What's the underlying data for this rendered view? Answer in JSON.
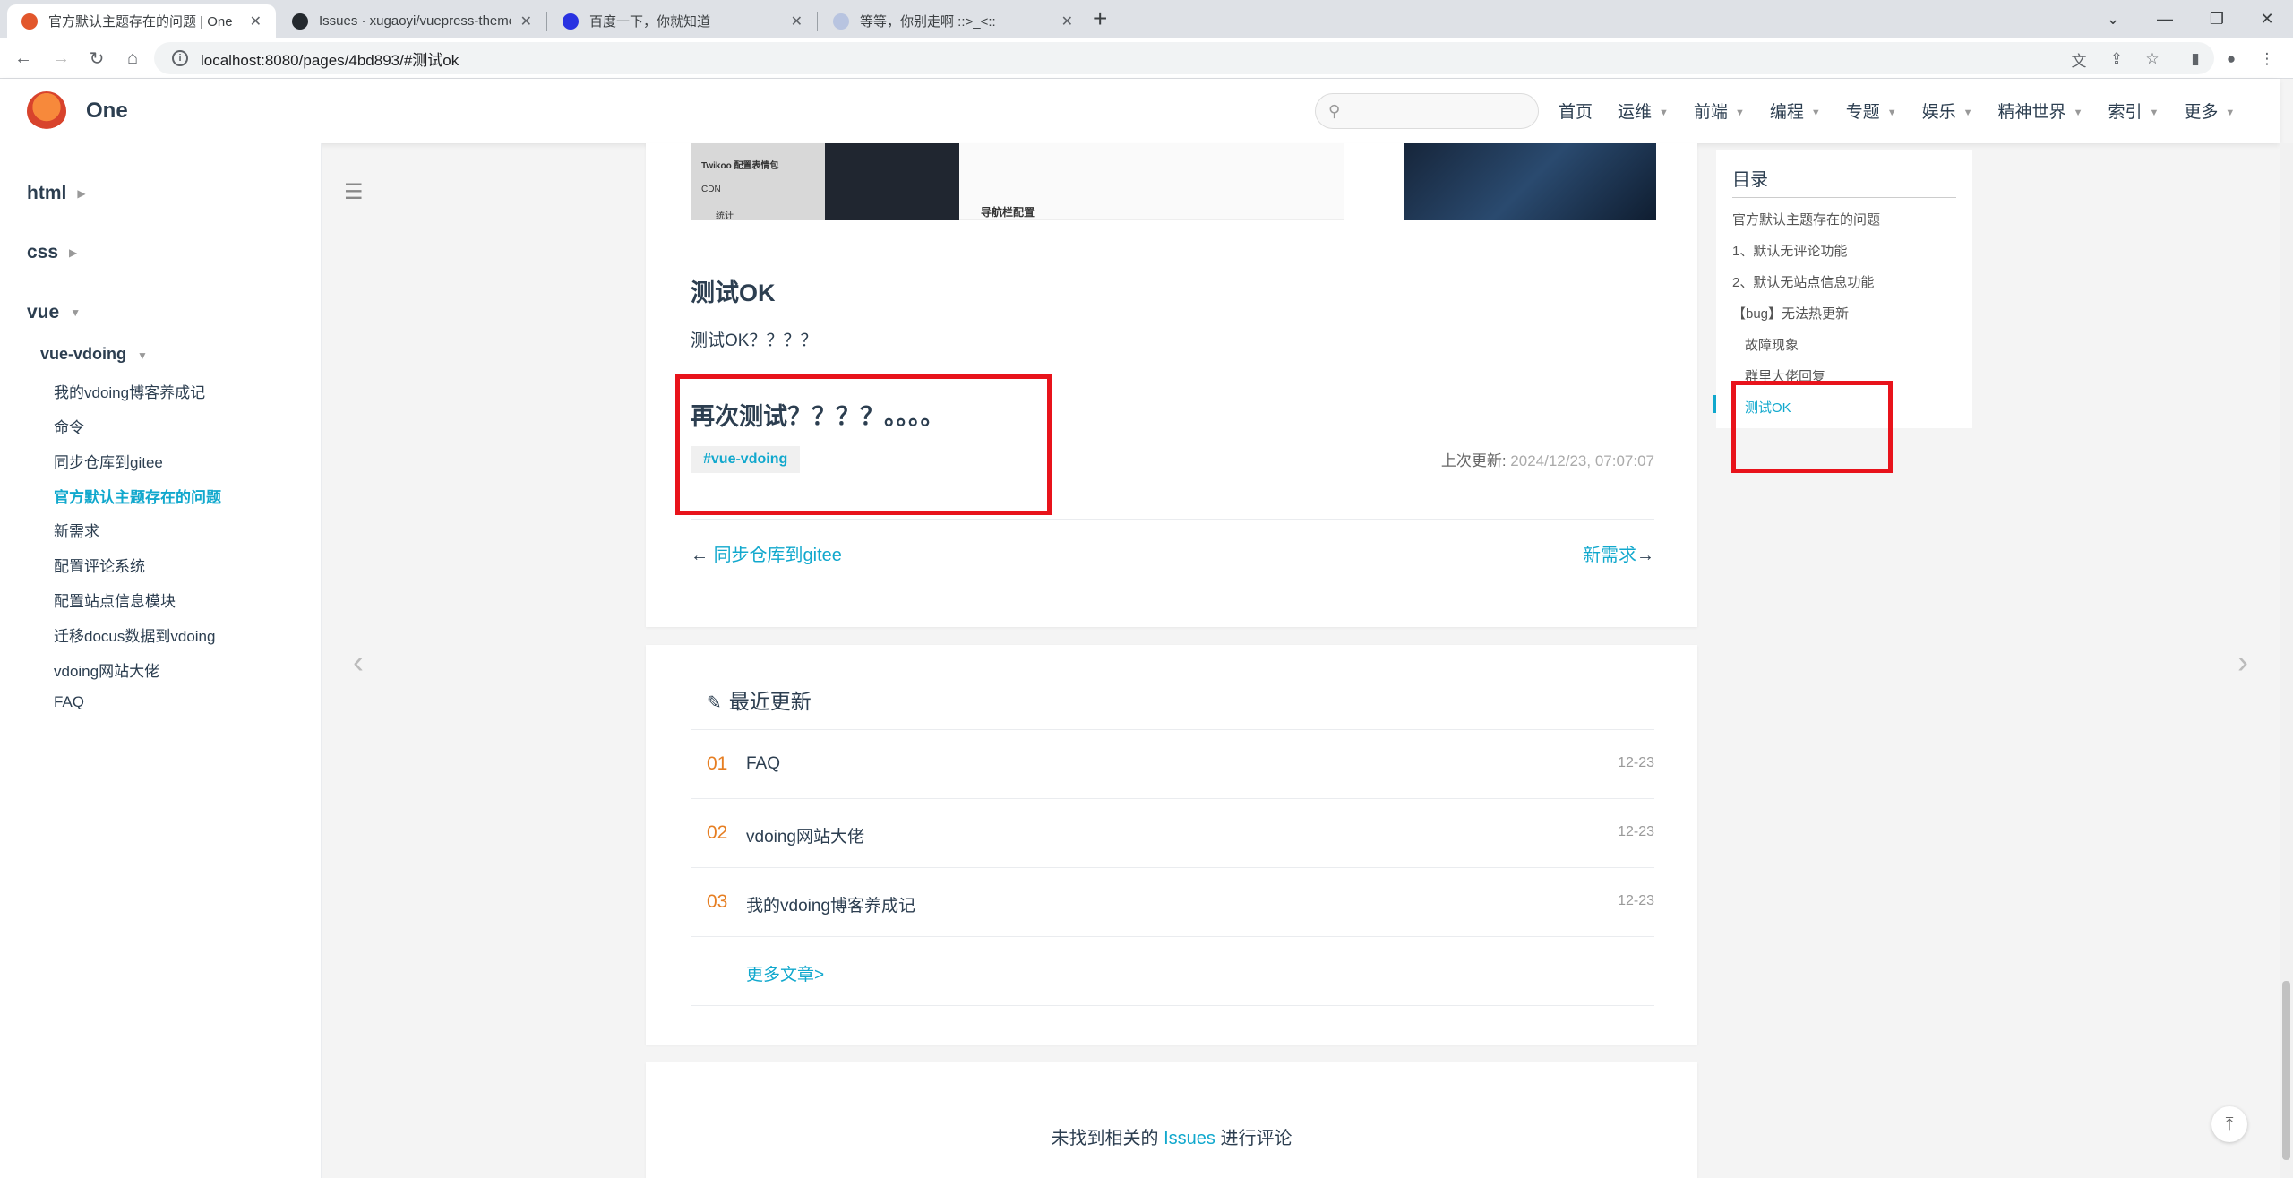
{
  "browser": {
    "tabs": [
      {
        "title": "官方默认主题存在的问题 | One",
        "active": true
      },
      {
        "title": "Issues · xugaoyi/vuepress-theme-vdoing"
      },
      {
        "title": "百度一下，你就知道"
      },
      {
        "title": "等等，你别走啊 ::>_<::"
      }
    ],
    "url": "localhost:8080/pages/4bd893/#测试ok"
  },
  "site": {
    "name": "One",
    "nav": [
      "首页",
      "运维",
      "前端",
      "编程",
      "专题",
      "娱乐",
      "精神世界",
      "索引",
      "更多"
    ]
  },
  "sidebar": {
    "groups": [
      "html",
      "css",
      "vue"
    ],
    "subgroup": "vue-vdoing",
    "items": [
      "我的vdoing博客养成记",
      "命令",
      "同步仓库到gitee",
      "官方默认主题存在的问题",
      "新需求",
      "配置评论系统",
      "配置站点信息模块",
      "迁移docus数据到vdoing",
      "vdoing网站大佬",
      "FAQ"
    ]
  },
  "article": {
    "thumb_texts": [
      "Twikoo 配置表情包",
      "CDN",
      "统计",
      "导航栏配置"
    ],
    "h2": "测试OK",
    "para": "测试OK？？？？",
    "h3": "再次测试？？？？。。。。",
    "tag": "#vue-vdoing",
    "updated_label": "上次更新:",
    "updated_time": "2024/12/23, 07:07:07",
    "prev": "同步仓库到gitee",
    "next": "新需求"
  },
  "recent": {
    "title": "最近更新",
    "rows": [
      {
        "num": "01",
        "name": "FAQ",
        "date": "12-23"
      },
      {
        "num": "02",
        "name": "vdoing网站大佬",
        "date": "12-23"
      },
      {
        "num": "03",
        "name": "我的vdoing博客养成记",
        "date": "12-23"
      }
    ],
    "more": "更多文章>"
  },
  "comment": {
    "prefix": "未找到相关的",
    "link": "Issues",
    "suffix": "进行评论"
  },
  "toc": {
    "title": "目录",
    "items": [
      "官方默认主题存在的问题",
      "1、默认无评论功能",
      "2、默认无站点信息功能",
      "【bug】无法热更新",
      "故障现象",
      "群里大佬回复",
      "测试OK"
    ]
  },
  "colors": {
    "accent": "#11a8cd",
    "highlight_box": "#e8131b",
    "number": "#e67e22"
  }
}
